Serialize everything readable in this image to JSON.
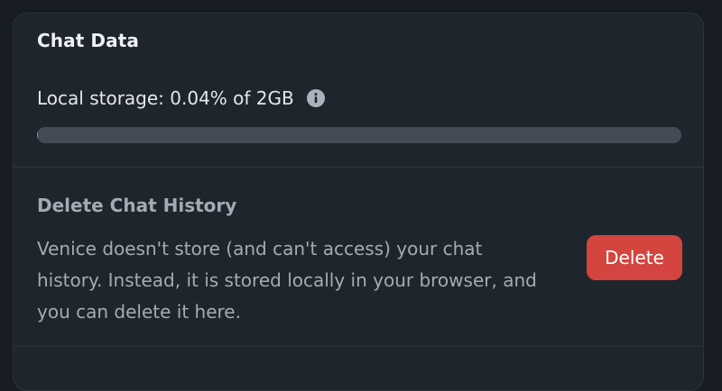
{
  "chat_data": {
    "title": "Chat Data",
    "storage": {
      "label": "Local storage: 0.04% of 2GB",
      "used_percent": 0.04,
      "info_icon": "info-icon"
    }
  },
  "delete_history": {
    "title": "Delete Chat History",
    "description": "Venice doesn't store (and can't access) your chat history. Instead, it is stored locally in your browser, and you can delete it here.",
    "button_label": "Delete",
    "button_color": "#d3453e"
  }
}
